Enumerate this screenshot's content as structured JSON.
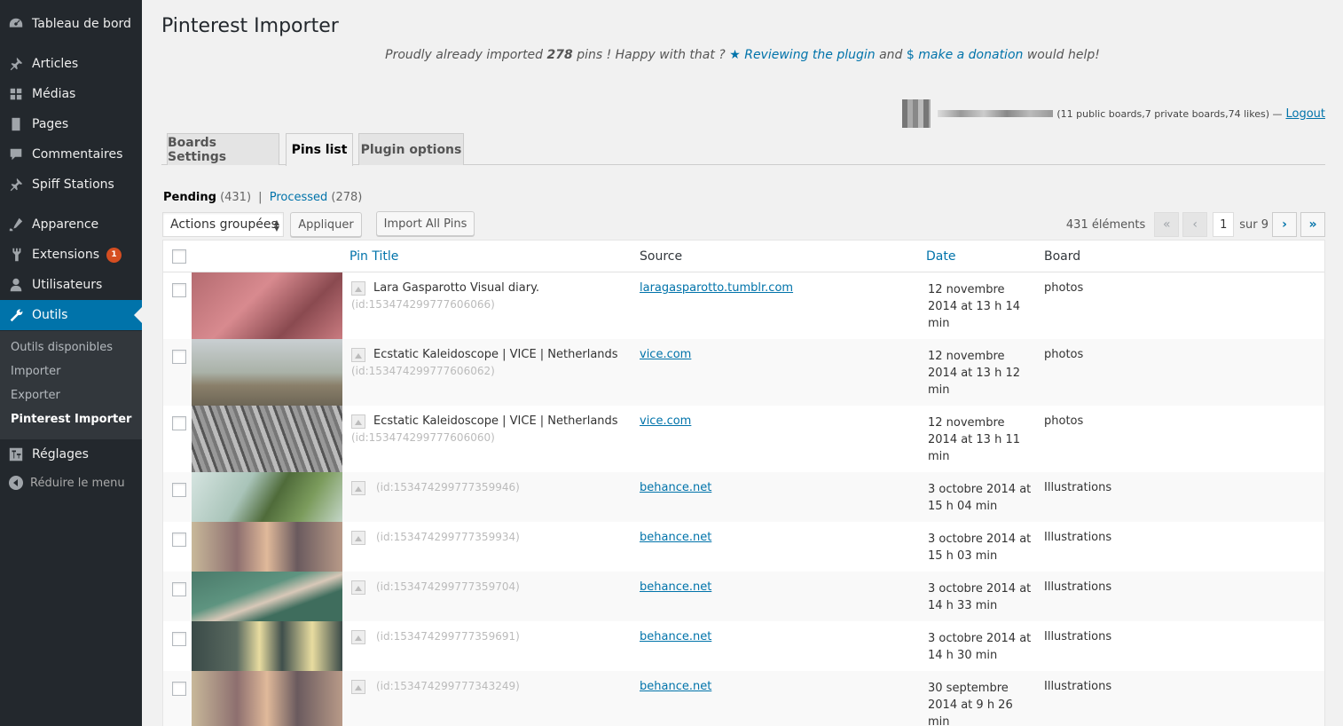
{
  "sidebar": {
    "items": [
      {
        "label": "Tableau de bord",
        "icon": "dashboard-icon"
      },
      {
        "label": "Articles",
        "icon": "pin-icon"
      },
      {
        "label": "Médias",
        "icon": "media-icon"
      },
      {
        "label": "Pages",
        "icon": "pages-icon"
      },
      {
        "label": "Commentaires",
        "icon": "comments-icon"
      },
      {
        "label": "Spiff Stations",
        "icon": "pin-icon"
      },
      {
        "label": "Apparence",
        "icon": "appearance-icon"
      },
      {
        "label": "Extensions",
        "icon": "plugins-icon",
        "badge": "1"
      },
      {
        "label": "Utilisateurs",
        "icon": "users-icon"
      },
      {
        "label": "Outils",
        "icon": "tools-icon"
      },
      {
        "label": "Réglages",
        "icon": "settings-icon"
      }
    ],
    "submenu": [
      "Outils disponibles",
      "Importer",
      "Exporter",
      "Pinterest Importer"
    ],
    "collapse_label": "Réduire le menu"
  },
  "page": {
    "title": "Pinterest Importer",
    "promo": {
      "prefix": "Proudly already imported",
      "count": "278",
      "middle": "pins ! Happy with that ?",
      "review_link": "Reviewing the plugin",
      "and": "and",
      "donation_link": "make a donation",
      "suffix": "would help!"
    },
    "account": {
      "stats": "(11 public boards,7 private boards,74 likes) —",
      "logout": "Logout"
    },
    "tabs": [
      "Boards Settings",
      "Pins list",
      "Plugin options"
    ],
    "views": {
      "pending_label": "Pending",
      "pending_count": "(431)",
      "separator": "|",
      "processed_label": "Processed",
      "processed_count": "(278)"
    },
    "bulk": {
      "select": "Actions groupées",
      "apply": "Appliquer",
      "import_all": "Import All Pins"
    },
    "pagination": {
      "items": "431 éléments",
      "first": "«",
      "prev": "‹",
      "current": "1",
      "of": "sur 9",
      "next": "›",
      "last": "»"
    },
    "columns": [
      "Pin Title",
      "Source",
      "Date",
      "Board"
    ],
    "rows": [
      {
        "title": "Lara Gasparotto Visual diary.",
        "id": "(id:153474299777606066)",
        "source": "laragasparotto.tumblr.com",
        "date": [
          "12 novembre",
          "2014 at 13 h 14",
          "min"
        ],
        "board": "photos"
      },
      {
        "title": "Ecstatic Kaleidoscope | VICE | Netherlands",
        "id": "(id:153474299777606062)",
        "source": "vice.com",
        "date": [
          "12 novembre",
          "2014 at 13 h 12",
          "min"
        ],
        "board": "photos"
      },
      {
        "title": "Ecstatic Kaleidoscope | VICE | Netherlands",
        "id": "(id:153474299777606060)",
        "source": "vice.com",
        "date": [
          "12 novembre",
          "2014 at 13 h 11",
          "min"
        ],
        "board": "photos"
      },
      {
        "title": "",
        "id": "(id:153474299777359946)",
        "source": "behance.net",
        "date": [
          "3 octobre 2014 at",
          "15 h 04 min"
        ],
        "board": "Illustrations"
      },
      {
        "title": "",
        "id": "(id:153474299777359934)",
        "source": "behance.net",
        "date": [
          "3 octobre 2014 at",
          "15 h 03 min"
        ],
        "board": "Illustrations"
      },
      {
        "title": "",
        "id": "(id:153474299777359704)",
        "source": "behance.net",
        "date": [
          "3 octobre 2014 at",
          "14 h 33 min"
        ],
        "board": "Illustrations"
      },
      {
        "title": "",
        "id": "(id:153474299777359691)",
        "source": "behance.net",
        "date": [
          "3 octobre 2014 at",
          "14 h 30 min"
        ],
        "board": "Illustrations"
      },
      {
        "title": "",
        "id": "(id:153474299777343249)",
        "source": "behance.net",
        "date": [
          "30 septembre",
          "2014 at 9 h 26",
          "min"
        ],
        "board": "Illustrations"
      }
    ]
  },
  "colors": {
    "accent": "#0073aa",
    "sidebar": "#23282d",
    "badge": "#d54e21"
  }
}
